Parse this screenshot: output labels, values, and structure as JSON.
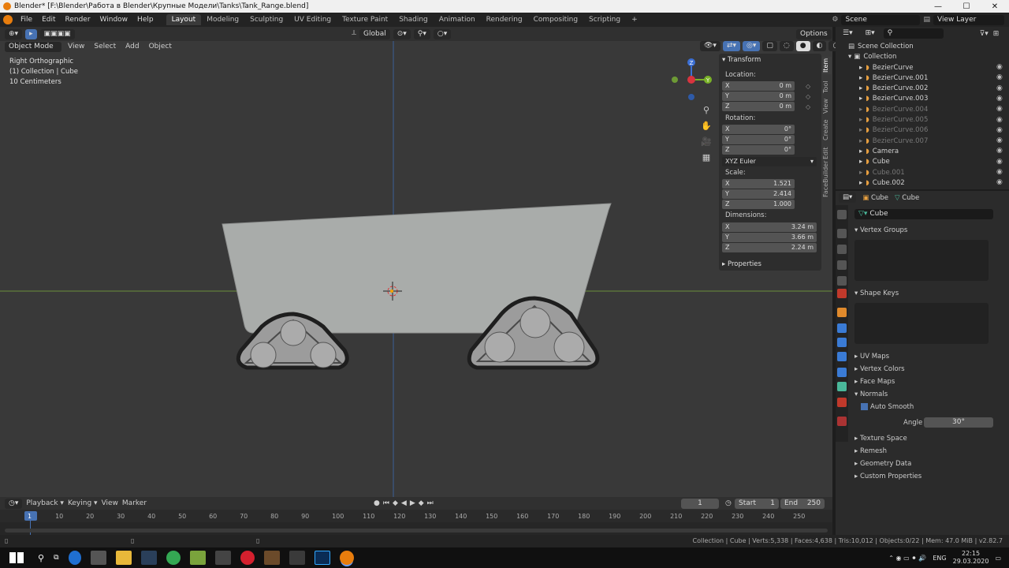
{
  "titlebar": {
    "title": "Blender* [F:\\Blender\\Работа в Blender\\Крупные Модели\\Tanks\\Tank_Range.blend]",
    "min": "—",
    "max": "☐",
    "close": "✕"
  },
  "menu": {
    "items": [
      "File",
      "Edit",
      "Render",
      "Window",
      "Help"
    ]
  },
  "workspaces": [
    "Layout",
    "Modeling",
    "Sculpting",
    "UV Editing",
    "Texture Paint",
    "Shading",
    "Animation",
    "Rendering",
    "Compositing",
    "Scripting",
    "+"
  ],
  "scene": {
    "label": "Scene",
    "view_layer": "View Layer"
  },
  "viewport_header": {
    "orientation": "Global",
    "options": "Options"
  },
  "viewport_header2": {
    "mode": "Object Mode",
    "view": "View",
    "select": "Select",
    "add": "Add",
    "object": "Object"
  },
  "viewport_info": {
    "line1": "Right Orthographic",
    "line2": "(1) Collection | Cube",
    "line3": "10 Centimeters"
  },
  "gizmo": {
    "z": "Z",
    "y": "Y"
  },
  "npanel": {
    "header": "Transform",
    "location_label": "Location:",
    "location": {
      "x": "0 m",
      "y": "0 m",
      "z": "0 m"
    },
    "rotation_label": "Rotation:",
    "rotation": {
      "x": "0°",
      "y": "0°",
      "z": "0°"
    },
    "rotation_mode": "XYZ Euler",
    "scale_label": "Scale:",
    "scale": {
      "x": "1.521",
      "y": "2.414",
      "z": "1.000"
    },
    "dimensions_label": "Dimensions:",
    "dimensions": {
      "x": "3.24 m",
      "y": "3.66 m",
      "z": "2.24 m"
    },
    "properties": "Properties",
    "axis_x": "X",
    "axis_y": "Y",
    "axis_z": "Z",
    "tabs": [
      "Item",
      "Tool",
      "View",
      "Create",
      "Edit",
      "FaceBuilder"
    ]
  },
  "outliner": {
    "title": "Scene Collection",
    "collection": "Collection",
    "items": [
      {
        "name": "BezierCurve",
        "dim": false
      },
      {
        "name": "BezierCurve.001",
        "dim": false
      },
      {
        "name": "BezierCurve.002",
        "dim": false
      },
      {
        "name": "BezierCurve.003",
        "dim": false
      },
      {
        "name": "BezierCurve.004",
        "dim": true
      },
      {
        "name": "BezierCurve.005",
        "dim": true
      },
      {
        "name": "BezierCurve.006",
        "dim": true
      },
      {
        "name": "BezierCurve.007",
        "dim": true
      },
      {
        "name": "Camera",
        "dim": false
      },
      {
        "name": "Cube",
        "dim": false
      },
      {
        "name": "Cube.001",
        "dim": true
      },
      {
        "name": "Cube.002",
        "dim": false
      }
    ]
  },
  "properties": {
    "breadcrumb_object": "Cube",
    "breadcrumb_data": "Cube",
    "mesh_name": "Cube",
    "vertex_groups": "Vertex Groups",
    "shape_keys": "Shape Keys",
    "uv_maps": "UV Maps",
    "vertex_colors": "Vertex Colors",
    "face_maps": "Face Maps",
    "normals": "Normals",
    "auto_smooth": "Auto Smooth",
    "angle_label": "Angle",
    "angle_value": "30°",
    "texture_space": "Texture Space",
    "remesh": "Remesh",
    "geometry_data": "Geometry Data",
    "custom_properties": "Custom Properties"
  },
  "timeline": {
    "playback": "Playback",
    "keying": "Keying",
    "view": "View",
    "marker": "Marker",
    "current_frame": "1",
    "start_label": "Start",
    "start": "1",
    "end_label": "End",
    "end": "250",
    "ruler": [
      "1",
      "10",
      "20",
      "30",
      "40",
      "50",
      "60",
      "70",
      "80",
      "90",
      "100",
      "110",
      "120",
      "130",
      "140",
      "150",
      "160",
      "170",
      "180",
      "190",
      "200",
      "210",
      "220",
      "230",
      "240",
      "250"
    ]
  },
  "status": {
    "text": "Collection | Cube | Verts:5,338 | Faces:4,638 | Tris:10,012 | Objects:0/22 | Mem: 47.0 MiB | v2.82.7"
  },
  "taskbar": {
    "lang": "ENG",
    "time": "22:15",
    "date": "29.03.2020"
  }
}
